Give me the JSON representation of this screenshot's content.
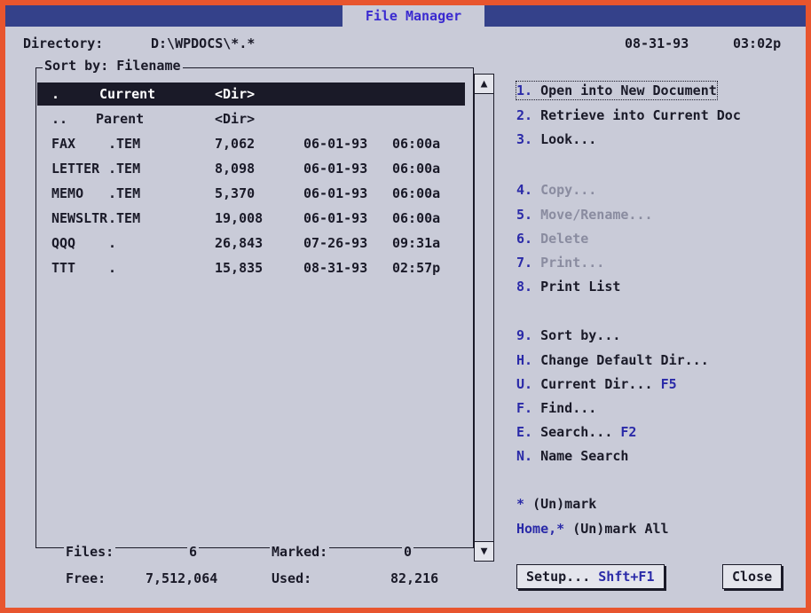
{
  "window": {
    "title": "File Manager"
  },
  "header": {
    "directory_label": "Directory:",
    "directory_value": "D:\\WPDOCS\\*.*",
    "date": "08-31-93",
    "time": "03:02p"
  },
  "list": {
    "sort_label": "Sort by: Filename",
    "rows": [
      {
        "name": ".",
        "ext": "Current",
        "size": "<Dir>",
        "date": "",
        "time": "",
        "selected": true
      },
      {
        "name": "..",
        "ext": "Parent",
        "size": "<Dir>",
        "date": "",
        "time": "",
        "selected": false
      },
      {
        "name": "FAX",
        "ext": ".TEM",
        "size": "7,062",
        "date": "06-01-93",
        "time": "06:00a",
        "selected": false
      },
      {
        "name": "LETTER",
        "ext": ".TEM",
        "size": "8,098",
        "date": "06-01-93",
        "time": "06:00a",
        "selected": false
      },
      {
        "name": "MEMO",
        "ext": ".TEM",
        "size": "5,370",
        "date": "06-01-93",
        "time": "06:00a",
        "selected": false
      },
      {
        "name": "NEWSLTR",
        "ext": ".TEM",
        "size": "19,008",
        "date": "06-01-93",
        "time": "06:00a",
        "selected": false
      },
      {
        "name": "QQQ",
        "ext": ".",
        "size": "26,843",
        "date": "07-26-93",
        "time": "09:31a",
        "selected": false
      },
      {
        "name": "TTT",
        "ext": ".",
        "size": "15,835",
        "date": "08-31-93",
        "time": "02:57p",
        "selected": false
      }
    ]
  },
  "stats": {
    "files_label": "Files:",
    "files_value": "6",
    "marked_label": "Marked:",
    "marked_value": "0",
    "free_label": "Free:",
    "free_value": "7,512,064",
    "used_label": "Used:",
    "used_value": "82,216"
  },
  "menu": [
    {
      "key": "1.",
      "text": "Open into New Document",
      "enabled": true,
      "focused": true
    },
    {
      "key": "2.",
      "text": "Retrieve into Current Doc",
      "enabled": true
    },
    {
      "key": "3.",
      "text": "Look...",
      "enabled": true
    },
    {
      "key": "4.",
      "text": "Copy...",
      "enabled": false
    },
    {
      "key": "5.",
      "text": "Move/Rename...",
      "enabled": false
    },
    {
      "key": "6.",
      "text": "Delete",
      "enabled": false
    },
    {
      "key": "7.",
      "text": "Print...",
      "enabled": false
    },
    {
      "key": "8.",
      "text": "Print List",
      "enabled": true
    },
    {
      "key": "9.",
      "text": "Sort by...",
      "enabled": true
    },
    {
      "key": "H.",
      "text": "Change Default Dir...",
      "enabled": true
    },
    {
      "key": "U.",
      "text": "Current Dir...",
      "shortcut": "F5",
      "enabled": true
    },
    {
      "key": "F.",
      "text": "Find...",
      "enabled": true
    },
    {
      "key": "E.",
      "text": "Search...",
      "shortcut": "F2",
      "enabled": true
    },
    {
      "key": "N.",
      "text": "Name Search",
      "enabled": true
    },
    {
      "key": "*",
      "text": "(Un)mark",
      "enabled": true
    },
    {
      "key": "Home,*",
      "text": "(Un)mark All",
      "enabled": true
    }
  ],
  "buttons": {
    "setup_label": "Setup...",
    "setup_shortcut": "Shft+F1",
    "close_label": "Close"
  },
  "icons": {
    "scroll_up": "up-arrow-icon",
    "scroll_down": "down-arrow-icon"
  },
  "colors": {
    "background": "#c9cbd8",
    "titlebar": "#34418a",
    "title_text": "#3a2ad0",
    "hotkey": "#2a2aa8",
    "selection": "#1a1a28",
    "border": "#e8552e"
  }
}
